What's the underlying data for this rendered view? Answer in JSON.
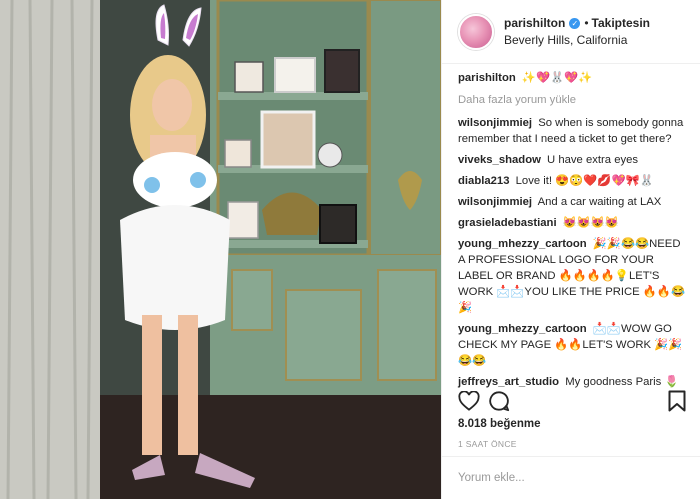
{
  "post": {
    "username": "parishilton",
    "follow_status": "Takiptesin",
    "location": "Beverly Hills, California",
    "caption_user": "parishilton",
    "caption_text": "✨💖🐰💖✨",
    "load_more": "Daha fazla yorum yükle",
    "likes": "8.018 beğenme",
    "time": "1 SAAT ÖNCE",
    "comment_placeholder": "Yorum ekle..."
  },
  "comments": [
    {
      "user": "wilsonjimmiej",
      "text": "So when is somebody gonna remember that I need a ticket to get there?"
    },
    {
      "user": "viveks_shadow",
      "text": "U have extra eyes"
    },
    {
      "user": "diabla213",
      "text": "Love it! 😍😳❤️💋💖🎀🐰"
    },
    {
      "user": "wilsonjimmiej",
      "text": "And a car waiting at LAX"
    },
    {
      "user": "grasieladebastiani",
      "text": "😻😻😻😻"
    },
    {
      "user": "young_mhezzy_cartoon",
      "text": "🎉🎉😂😂NEED A PROFESSIONAL LOGO FOR YOUR LABEL OR BRAND 🔥🔥🔥🔥💡LET'S WORK 📩📩YOU LIKE THE PRICE 🔥🔥😂🎉"
    },
    {
      "user": "young_mhezzy_cartoon",
      "text": "📩📩WOW GO CHECK MY PAGE 🔥🔥LET'S WORK 🎉🎉😂😂"
    },
    {
      "user": "jeffreys_art_studio",
      "text": "My goodness Paris 🌷🌷"
    }
  ],
  "icons": {
    "verified": "verified-badge-icon",
    "like": "heart-icon",
    "comment": "comment-bubble-icon",
    "save": "bookmark-icon"
  },
  "colors": {
    "accent": "#3897f0",
    "muted": "#999999",
    "text": "#262626"
  }
}
